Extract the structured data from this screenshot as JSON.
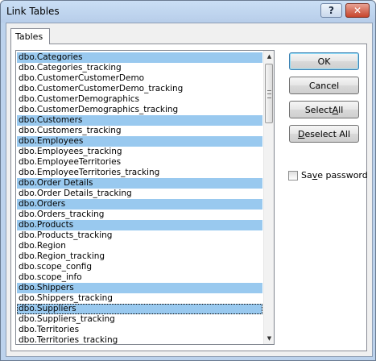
{
  "window": {
    "title": "Link Tables",
    "help_label": "?",
    "close_label": "✕"
  },
  "tab": {
    "label": "Tables"
  },
  "tables": [
    {
      "name": "dbo.Categories",
      "selected": true
    },
    {
      "name": "dbo.Categories_tracking",
      "selected": false
    },
    {
      "name": "dbo.CustomerCustomerDemo",
      "selected": false
    },
    {
      "name": "dbo.CustomerCustomerDemo_tracking",
      "selected": false
    },
    {
      "name": "dbo.CustomerDemographics",
      "selected": false
    },
    {
      "name": "dbo.CustomerDemographics_tracking",
      "selected": false
    },
    {
      "name": "dbo.Customers",
      "selected": true
    },
    {
      "name": "dbo.Customers_tracking",
      "selected": false
    },
    {
      "name": "dbo.Employees",
      "selected": true
    },
    {
      "name": "dbo.Employees_tracking",
      "selected": false
    },
    {
      "name": "dbo.EmployeeTerritories",
      "selected": false
    },
    {
      "name": "dbo.EmployeeTerritories_tracking",
      "selected": false
    },
    {
      "name": "dbo.Order Details",
      "selected": true
    },
    {
      "name": "dbo.Order Details_tracking",
      "selected": false
    },
    {
      "name": "dbo.Orders",
      "selected": true
    },
    {
      "name": "dbo.Orders_tracking",
      "selected": false
    },
    {
      "name": "dbo.Products",
      "selected": true
    },
    {
      "name": "dbo.Products_tracking",
      "selected": false
    },
    {
      "name": "dbo.Region",
      "selected": false
    },
    {
      "name": "dbo.Region_tracking",
      "selected": false
    },
    {
      "name": "dbo.scope_config",
      "selected": false
    },
    {
      "name": "dbo.scope_info",
      "selected": false
    },
    {
      "name": "dbo.Shippers",
      "selected": true
    },
    {
      "name": "dbo.Shippers_tracking",
      "selected": false
    },
    {
      "name": "dbo.Suppliers",
      "selected": true,
      "focused": true
    },
    {
      "name": "dbo.Suppliers_tracking",
      "selected": false
    },
    {
      "name": "dbo.Territories",
      "selected": false
    },
    {
      "name": "dbo.Territories_tracking",
      "selected": false
    }
  ],
  "buttons": {
    "ok": "OK",
    "cancel": "Cancel",
    "select_all_pre": "Select ",
    "select_all_key": "A",
    "select_all_post": "ll",
    "deselect_all_key": "D",
    "deselect_all_post": "eselect All"
  },
  "save_password": {
    "pre": "Sa",
    "key": "v",
    "post": "e password",
    "checked": false
  },
  "scrollbar": {
    "up_icon": "▲",
    "down_icon": "▼"
  },
  "colors": {
    "selection": "#99c9ef",
    "window_frame": "#bcd2ec"
  }
}
